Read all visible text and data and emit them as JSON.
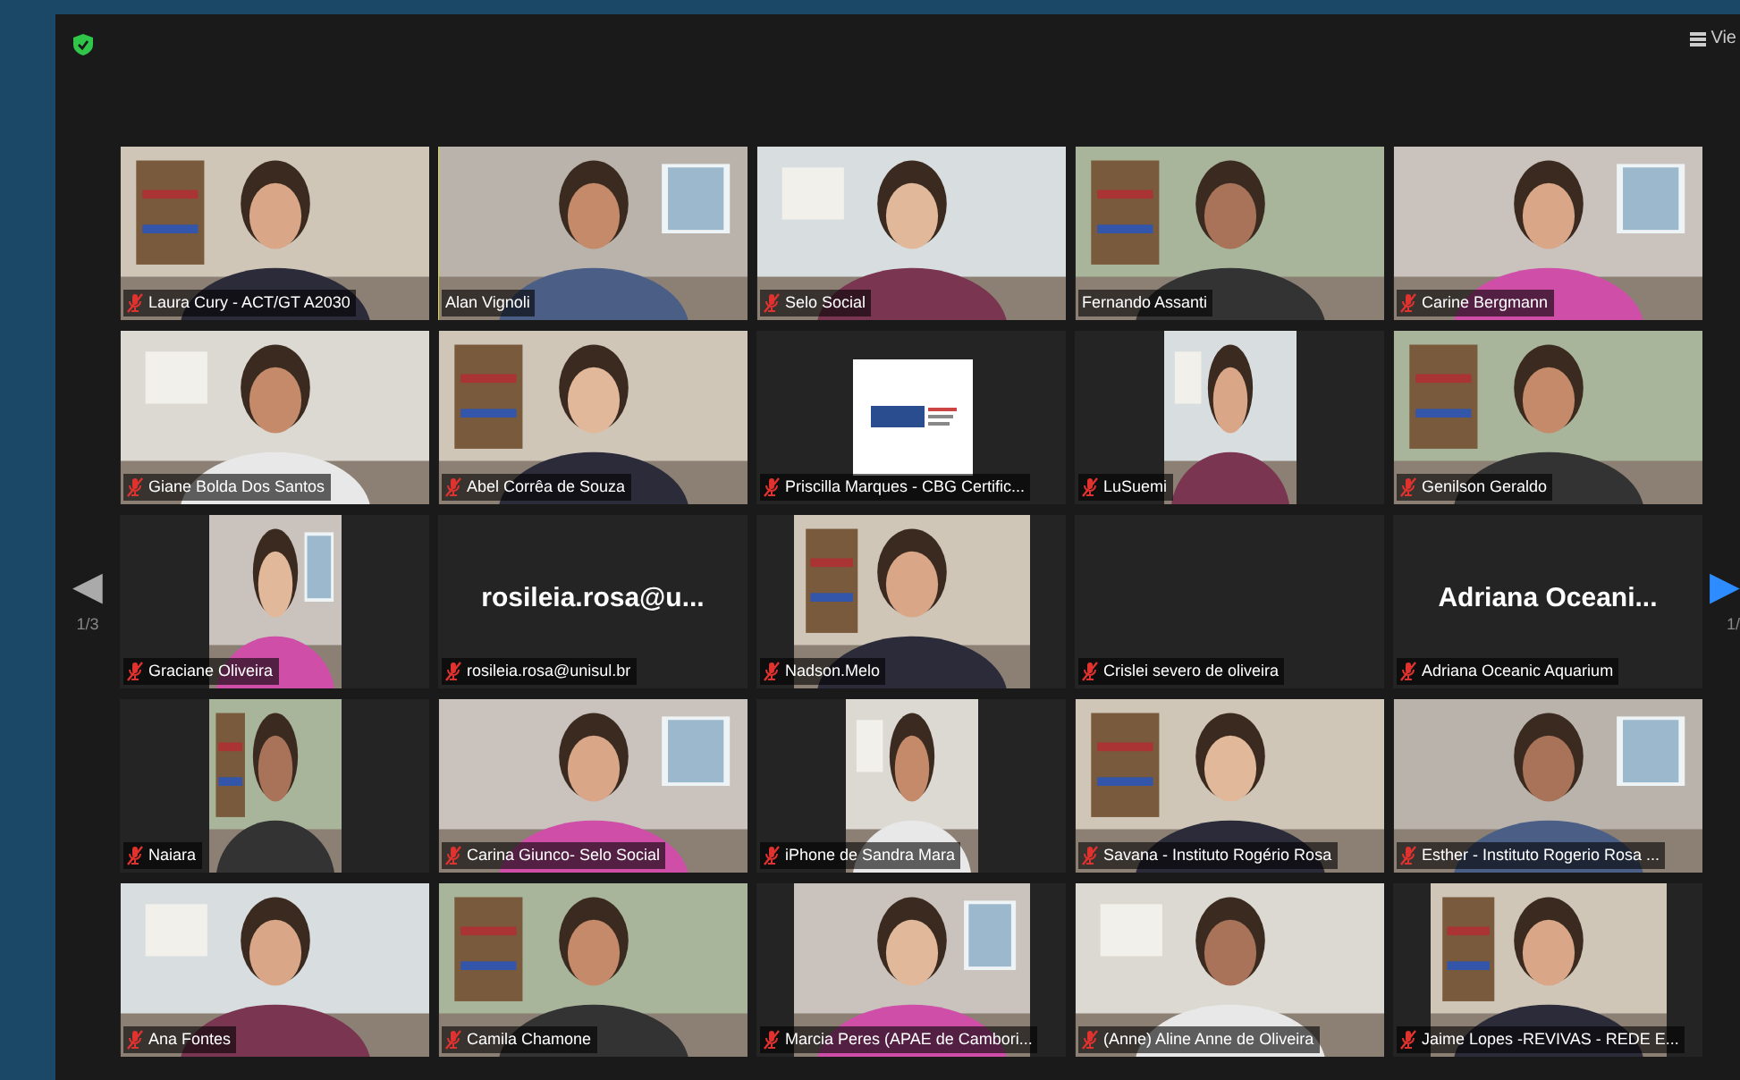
{
  "top_bar": {
    "secure": true,
    "view_button": "Vie"
  },
  "pager_left": {
    "arrow": "◀",
    "page": "1/3"
  },
  "pager_right": {
    "arrow": "▶",
    "page": "1/"
  },
  "tiles": [
    {
      "name": "Laura Cury - ACT/GT A2030",
      "kind": "video",
      "muted": true,
      "speaking": false
    },
    {
      "name": "Alan Vignoli",
      "kind": "video",
      "muted": false,
      "speaking": true
    },
    {
      "name": "Selo Social",
      "kind": "video",
      "muted": true,
      "speaking": false
    },
    {
      "name": "Fernando Assanti",
      "kind": "video",
      "muted": false,
      "speaking": false
    },
    {
      "name": "Carine Bergmann",
      "kind": "video",
      "muted": true,
      "speaking": false
    },
    {
      "name": "Giane Bolda Dos Santos",
      "kind": "video",
      "muted": true,
      "speaking": false
    },
    {
      "name": "Abel Corrêa de Souza",
      "kind": "video",
      "muted": true,
      "speaking": false
    },
    {
      "name": "Priscilla Marques - CBG Certific...",
      "kind": "logo",
      "muted": true,
      "speaking": false
    },
    {
      "name": "LuSuemi",
      "kind": "portrait",
      "muted": true,
      "speaking": false
    },
    {
      "name": "Genilson Geraldo",
      "kind": "video",
      "muted": true,
      "speaking": false
    },
    {
      "name": "Graciane Oliveira",
      "kind": "portrait",
      "muted": true,
      "speaking": false
    },
    {
      "name": "rosileia.rosa@unisul.br",
      "kind": "name",
      "display": "rosileia.rosa@u...",
      "muted": true,
      "speaking": false
    },
    {
      "name": "Nadson.Melo",
      "kind": "wide",
      "muted": true,
      "speaking": false
    },
    {
      "name": "Crislei severo de oliveira",
      "kind": "empty",
      "muted": true,
      "speaking": false
    },
    {
      "name": "Adriana Oceanic Aquarium",
      "kind": "name",
      "display": "Adriana  Oceani...",
      "muted": true,
      "speaking": false
    },
    {
      "name": "Naiara",
      "kind": "portrait",
      "muted": true,
      "speaking": false
    },
    {
      "name": "Carina Giunco- Selo Social",
      "kind": "video",
      "muted": true,
      "speaking": false
    },
    {
      "name": "iPhone de Sandra Mara",
      "kind": "portrait",
      "muted": true,
      "speaking": false
    },
    {
      "name": "Savana - Instituto Rogério Rosa",
      "kind": "video",
      "muted": true,
      "speaking": false
    },
    {
      "name": "Esther - Instituto Rogerio Rosa ...",
      "kind": "video",
      "muted": true,
      "speaking": false
    },
    {
      "name": "Ana Fontes",
      "kind": "video",
      "muted": true,
      "speaking": false
    },
    {
      "name": "Camila Chamone",
      "kind": "video",
      "muted": true,
      "speaking": false
    },
    {
      "name": "Marcia Peres (APAE de Cambori...",
      "kind": "wide",
      "muted": true,
      "speaking": false
    },
    {
      "name": "(Anne) Aline Anne de Oliveira",
      "kind": "video",
      "muted": true,
      "speaking": false
    },
    {
      "name": "Jaime Lopes -REVIVAS - REDE E...",
      "kind": "wide",
      "muted": true,
      "speaking": false
    }
  ]
}
